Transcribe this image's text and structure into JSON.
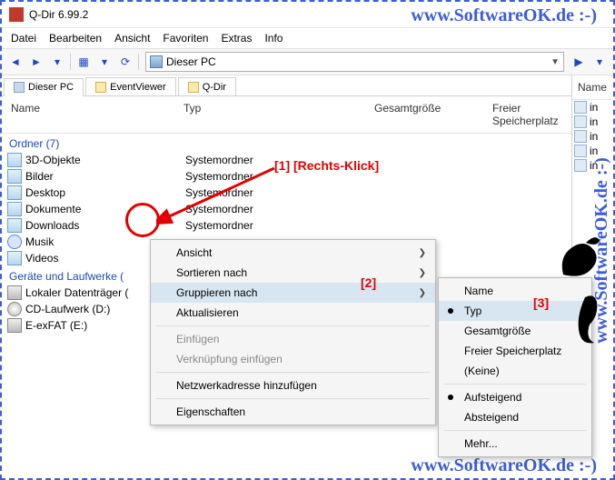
{
  "watermark": "www.SoftwareOK.de :-)",
  "title": "Q-Dir 6.99.2",
  "menu": {
    "datei": "Datei",
    "bearb": "Bearbeiten",
    "ansicht": "Ansicht",
    "fav": "Favoriten",
    "extras": "Extras",
    "info": "Info"
  },
  "addr": "Dieser PC",
  "tabs": {
    "t1": "Dieser PC",
    "t2": "EventViewer",
    "t3": "Q-Dir"
  },
  "cols": {
    "name": "Name",
    "typ": "Typ",
    "gr": "Gesamtgröße",
    "fr": "Freier Speicherplatz"
  },
  "group_ordner": "Ordner (7)",
  "folders": {
    "f0": {
      "name": "3D-Objekte",
      "typ": "Systemordner"
    },
    "f1": {
      "name": "Bilder",
      "typ": "Systemordner"
    },
    "f2": {
      "name": "Desktop",
      "typ": "Systemordner"
    },
    "f3": {
      "name": "Dokumente",
      "typ": "Systemordner"
    },
    "f4": {
      "name": "Downloads",
      "typ": "Systemordner"
    },
    "f5": {
      "name": "Musik",
      "typ": ""
    },
    "f6": {
      "name": "Videos",
      "typ": ""
    }
  },
  "group_drives": "Geräte und Laufwerke (",
  "drives": {
    "d0": "Lokaler Datenträger (",
    "d1": "CD-Laufwerk (D:)",
    "d2": "E-exFAT (E:)"
  },
  "r_col": "Name",
  "r_items": {
    "r0": "in",
    "r1": "in",
    "r2": "in",
    "r3": "in",
    "r4": "in"
  },
  "ctx1": {
    "ansicht": "Ansicht",
    "sort": "Sortieren nach",
    "grupp": "Gruppieren nach",
    "akt": "Aktualisieren",
    "einf": "Einfügen",
    "verk": "Verknüpfung einfügen",
    "netz": "Netzwerkadresse hinzufügen",
    "eig": "Eigenschaften"
  },
  "ctx2": {
    "name": "Name",
    "typ": "Typ",
    "gr": "Gesamtgröße",
    "fr": "Freier Speicherplatz",
    "keine": "(Keine)",
    "auf": "Aufsteigend",
    "ab": "Absteigend",
    "mehr": "Mehr..."
  },
  "anno": {
    "a1": "[1] [Rechts-Klick]",
    "a2": "[2]",
    "a3": "[3]"
  }
}
